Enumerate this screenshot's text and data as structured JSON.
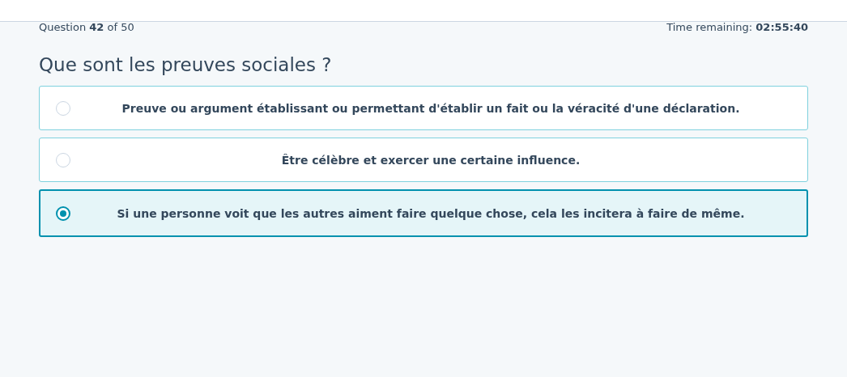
{
  "progress": "Question **42** of 50",
  "timer": "Time remaining: **02:55:40**",
  "question": "Que sont les preuves sociales ?",
  "options": [
    {
      "label": "Preuve ou argument établissant ou permettant d'établir un fait ou la véracité d'une déclaration.",
      "selected": false
    },
    {
      "label": "Être célèbre et exercer une certaine influence.",
      "selected": false
    },
    {
      "label": "Si une personne voit que les autres aiment faire quelque chose, cela les incitera à faire de même.",
      "selected": true
    }
  ]
}
